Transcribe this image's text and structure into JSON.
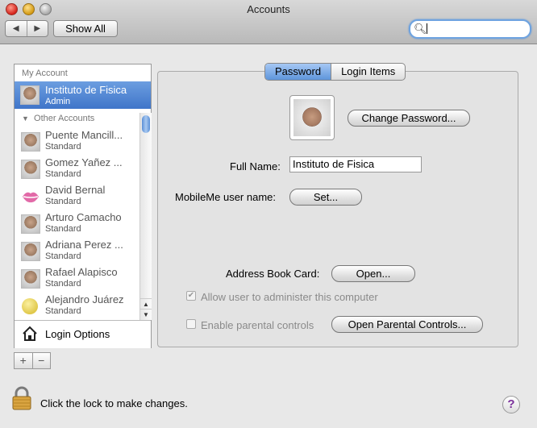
{
  "window": {
    "title": "Accounts"
  },
  "toolbar": {
    "show_all": "Show All",
    "search": {
      "value": "",
      "placeholder": ""
    }
  },
  "sidebar": {
    "my_account_header": "My Account",
    "selected": {
      "name": "Instituto de Fisica",
      "role": "Admin"
    },
    "other_header": "Other Accounts",
    "accounts": [
      {
        "name": "Puente Mancill...",
        "role": "Standard",
        "avatar": "photo"
      },
      {
        "name": "Gomez Yañez ...",
        "role": "Standard",
        "avatar": "photo"
      },
      {
        "name": "David Bernal",
        "role": "Standard",
        "avatar": "lips"
      },
      {
        "name": "Arturo Camacho",
        "role": "Standard",
        "avatar": "photo"
      },
      {
        "name": "Adriana Perez ...",
        "role": "Standard",
        "avatar": "photo"
      },
      {
        "name": "Rafael Alapisco",
        "role": "Standard",
        "avatar": "photo"
      },
      {
        "name": "Alejandro Juárez",
        "role": "Standard",
        "avatar": "tennis-ball"
      }
    ],
    "login_options": "Login Options",
    "add_symbol": "+",
    "remove_symbol": "−"
  },
  "tabs": [
    {
      "label": "Password",
      "active": true
    },
    {
      "label": "Login Items",
      "active": false
    }
  ],
  "main": {
    "change_password": "Change Password...",
    "full_name_label": "Full Name:",
    "full_name_value": "Instituto de Fisica",
    "mobileme_label": "MobileMe user name:",
    "set_button": "Set...",
    "address_book_label": "Address Book Card:",
    "open_button": "Open...",
    "allow_admin": {
      "label": "Allow user to administer this computer",
      "checked": true,
      "enabled": false
    },
    "parental": {
      "label": "Enable parental controls",
      "checked": false,
      "enabled": false
    },
    "open_parental_button": "Open Parental Controls..."
  },
  "footer": {
    "lock_text": "Click the lock to make changes.",
    "help": "?"
  },
  "colors": {
    "selection": "#3f75c9",
    "tab_active": "#5e95db",
    "help": "#7a2f9a"
  }
}
